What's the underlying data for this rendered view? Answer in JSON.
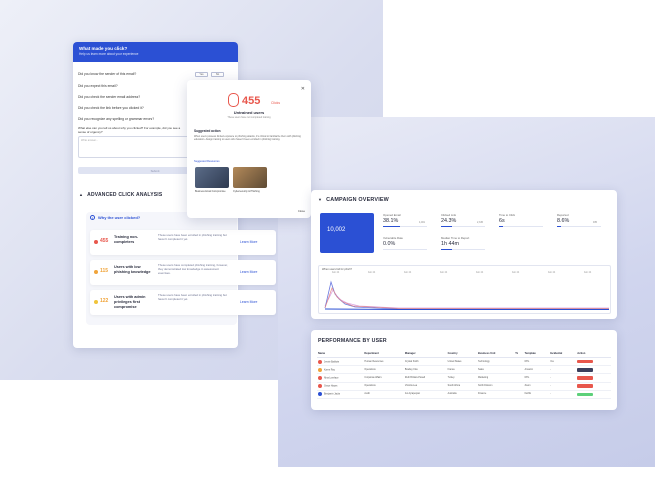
{
  "survey": {
    "title": "What made you click?",
    "subtitle": "Help us learn more about your experience",
    "questions": [
      "Did you know the sender of this email?",
      "Did you expect this email?",
      "Did you check the sender email address?",
      "Did you check the link before you clicked it?",
      "Did you recognize any spelling or grammar errors?"
    ],
    "yes_label": "Yes",
    "no_label": "No",
    "open_question": "What else can you tell us about why you clicked? For example, did you see a sense of urgency?",
    "textarea_placeholder": "Write answer...",
    "submit_label": "Submit"
  },
  "advanced": {
    "title": "ADVANCED CLICK ANALYSIS",
    "why_title": "Why the user clicked?",
    "rows": [
      {
        "value": "455",
        "label": "Training non-completers",
        "desc": "These users have been enrolled in phishing training but haven't completed it yet.",
        "link": "Learn More",
        "color": "#e8574c"
      },
      {
        "value": "115",
        "label": "Users with low phishing knowledge",
        "desc": "These users have completed phishing training, however, they demonstrated low knowledge in assessment exercises.",
        "link": "Learn More",
        "color": "#f0a43a"
      },
      {
        "value": "122",
        "label": "Users with admin privileges first compromise",
        "desc": "These users have been enrolled in phishing training but haven't completed it yet.",
        "link": "Learn More",
        "color": "#f0c43a"
      }
    ]
  },
  "popup": {
    "count": "455",
    "unit": "Clicks",
    "headline": "Untrained users",
    "sub": "These users have not completed training",
    "section_title": "Suggested action",
    "body": "When users possess limited exposure to phishing attacks, it's critical to familiarize them with phishing education. Assign training to users who haven't been enrolled in phishing training.",
    "resources_label": "Suggested Resources",
    "thumbs": [
      {
        "caption": "Business Email Compromise",
        "color": "#3b4a63"
      },
      {
        "caption": "Cybersecurity & Phishing",
        "color": "#8f6a45"
      }
    ],
    "close_label": "Close"
  },
  "campaign": {
    "title": "CAMPAIGN OVERVIEW",
    "hero_value": "10,002",
    "stats": [
      {
        "key": "Opened Email",
        "value": "38.1%",
        "right": "4,001",
        "fill": 0.38
      },
      {
        "key": "Clicked Link",
        "value": "24.3%",
        "right": "2,345",
        "fill": 0.24
      },
      {
        "key": "Time to Click",
        "value": "6s",
        "right": "",
        "fill": 0.1
      },
      {
        "key": "Reported",
        "value": "8.6%",
        "right": "935",
        "fill": 0.09
      },
      {
        "key": "Vulnerable Rate",
        "value": "0.0%",
        "right": "",
        "fill": 0.0
      },
      {
        "key": "Median Time to Report",
        "value": "1h 44m",
        "right": "",
        "fill": 0.25
      }
    ],
    "chart_title": "When users fall for phish?",
    "date_labels": [
      "Feb 24",
      "Feb 24",
      "Feb 24",
      "Feb 24",
      "Feb 24",
      "Feb 24",
      "Feb 24",
      "Feb 24",
      "Feb 24"
    ]
  },
  "performance": {
    "title": "PERFORMANCE BY USER",
    "columns": [
      "Name",
      "Department",
      "Manager",
      "Country",
      "Business Unit",
      "Tz",
      "Template",
      "Incidental",
      "Action"
    ],
    "rows": [
      {
        "name": "Jessie Baldwin",
        "dept": "Human Resources",
        "mgr": "Crystal Smith",
        "country": "United States",
        "unit": "Technology",
        "tz": "",
        "template": "DHL",
        "incid": "Yes",
        "action_color": "#e8574c",
        "av": "#e8574c"
      },
      {
        "name": "Karen Ray",
        "dept": "Operations",
        "mgr": "Bradley Kiss",
        "country": "France",
        "unit": "Sales",
        "tz": "",
        "template": "Amazon",
        "incid": "-",
        "action_color": "#3b3f5c",
        "av": "#f0a43a"
      },
      {
        "name": "Nina Lovelace",
        "dept": "Corporate Affairs",
        "mgr": "Ruth Brittain-Powell",
        "country": "Turkey",
        "unit": "Marketing",
        "tz": "",
        "template": "DHL",
        "incid": "-",
        "action_color": "#e8574c",
        "av": "#e8574c"
      },
      {
        "name": "Grace Hayes",
        "dept": "Operations",
        "mgr": "Victoria Lea",
        "country": "South Africa",
        "unit": "North Division",
        "tz": "",
        "template": "Zoom",
        "incid": "-",
        "action_color": "#e8574c",
        "av": "#e8574c"
      },
      {
        "name": "Benjamin Jacks",
        "dept": "Audit",
        "mgr": "Ivo Ayrapetyan",
        "country": "Australia",
        "unit": "Finance",
        "tz": "",
        "template": "Netflix",
        "incid": "-",
        "action_color": "#5cd07a",
        "av": "#2b50d4"
      }
    ]
  }
}
